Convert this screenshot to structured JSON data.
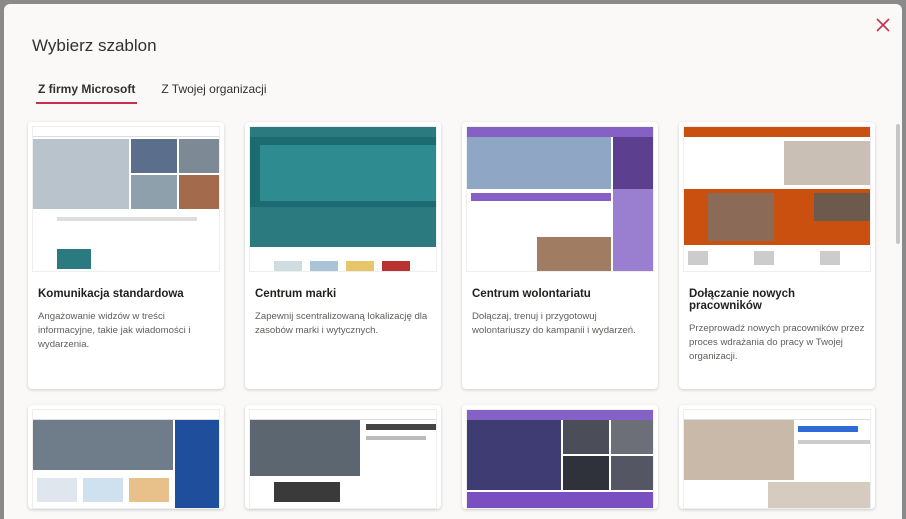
{
  "dialog": {
    "title": "Wybierz szablon",
    "tabs": [
      {
        "label": "Z firmy Microsoft",
        "active": true
      },
      {
        "label": "Z Twojej organizacji",
        "active": false
      }
    ]
  },
  "templates": [
    {
      "title": "Komunikacja standardowa",
      "description": "Angażowanie widzów w treści informacyjne, takie jak wiadomości i wydarzenia.",
      "accent": "#0f6cbd"
    },
    {
      "title": "Centrum marki",
      "description": "Zapewnij scentralizowaną lokalizację dla zasobów marki i wytycznych.",
      "accent": "#2b7a7f"
    },
    {
      "title": "Centrum wolontariatu",
      "description": "Dołączaj, trenuj i przygotowuj wolontariuszy do kampanii i wydarzeń.",
      "accent": "#8661c5"
    },
    {
      "title": "Dołączanie nowych pracowników",
      "description": "Przeprowadź nowych pracowników przez proces wdrażania do pracy w Twojej organizacji.",
      "accent": "#ca5010"
    }
  ],
  "templates_row2": [
    {
      "accent": "#1f4e9c"
    },
    {
      "accent": "#444444"
    },
    {
      "accent": "#7a4fc0"
    },
    {
      "accent": "#2e6bd6"
    }
  ],
  "colors": {
    "tab_underline": "#c4314b",
    "close_icon": "#c4314b"
  }
}
